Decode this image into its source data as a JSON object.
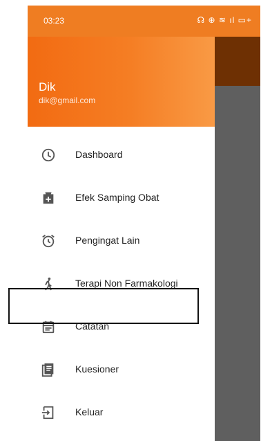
{
  "status_bar": {
    "time": "03:23",
    "icons_text": "☊ ⊕ ≋ ıl ▭+"
  },
  "drawer": {
    "user_name": "Dik",
    "user_email": "dik@gmail.com",
    "items": [
      {
        "label": "Dashboard",
        "icon": "clock-icon"
      },
      {
        "label": "Efek Samping Obat",
        "icon": "medical-bag-icon"
      },
      {
        "label": "Pengingat Lain",
        "icon": "alarm-clock-icon"
      },
      {
        "label": "Terapi Non Farmakologi",
        "icon": "walking-person-icon"
      },
      {
        "label": "Catatan",
        "icon": "calendar-icon"
      },
      {
        "label": "Kuesioner",
        "icon": "document-icon"
      },
      {
        "label": "Keluar",
        "icon": "logout-icon"
      }
    ]
  },
  "colors": {
    "status_bar": "#ef7d22",
    "header_start": "#f26b12",
    "header_end": "#f99a45",
    "scrim": "#5f5f5f",
    "app_bar_under_scrim": "#6e3003",
    "icon": "#555555"
  }
}
